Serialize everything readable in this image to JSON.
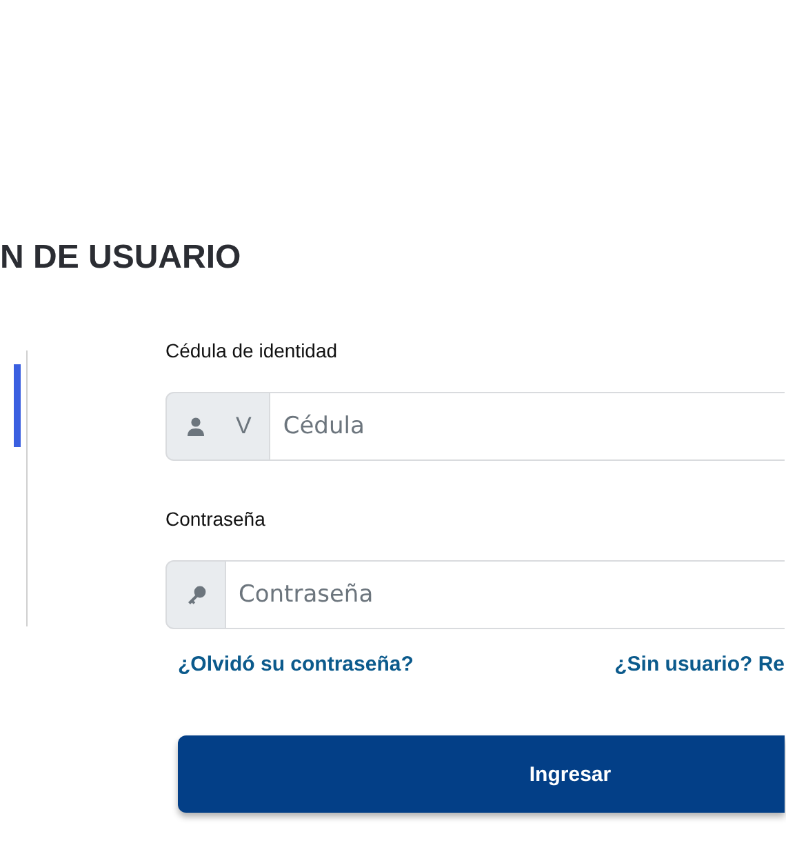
{
  "page_title": "N DE USUARIO",
  "side_tabs": [
    {
      "selected": true
    }
  ],
  "fields": [
    {
      "kind": "cedula",
      "label": "Cédula de identidad",
      "prefix": "V",
      "placeholder": "Cédula"
    },
    {
      "kind": "password",
      "label": "Contraseña",
      "placeholder": "Contraseña"
    }
  ],
  "links": [
    "¿Olvidó su contraseña?",
    "¿Sin usuario? Re"
  ],
  "submit": "Ingresar"
}
